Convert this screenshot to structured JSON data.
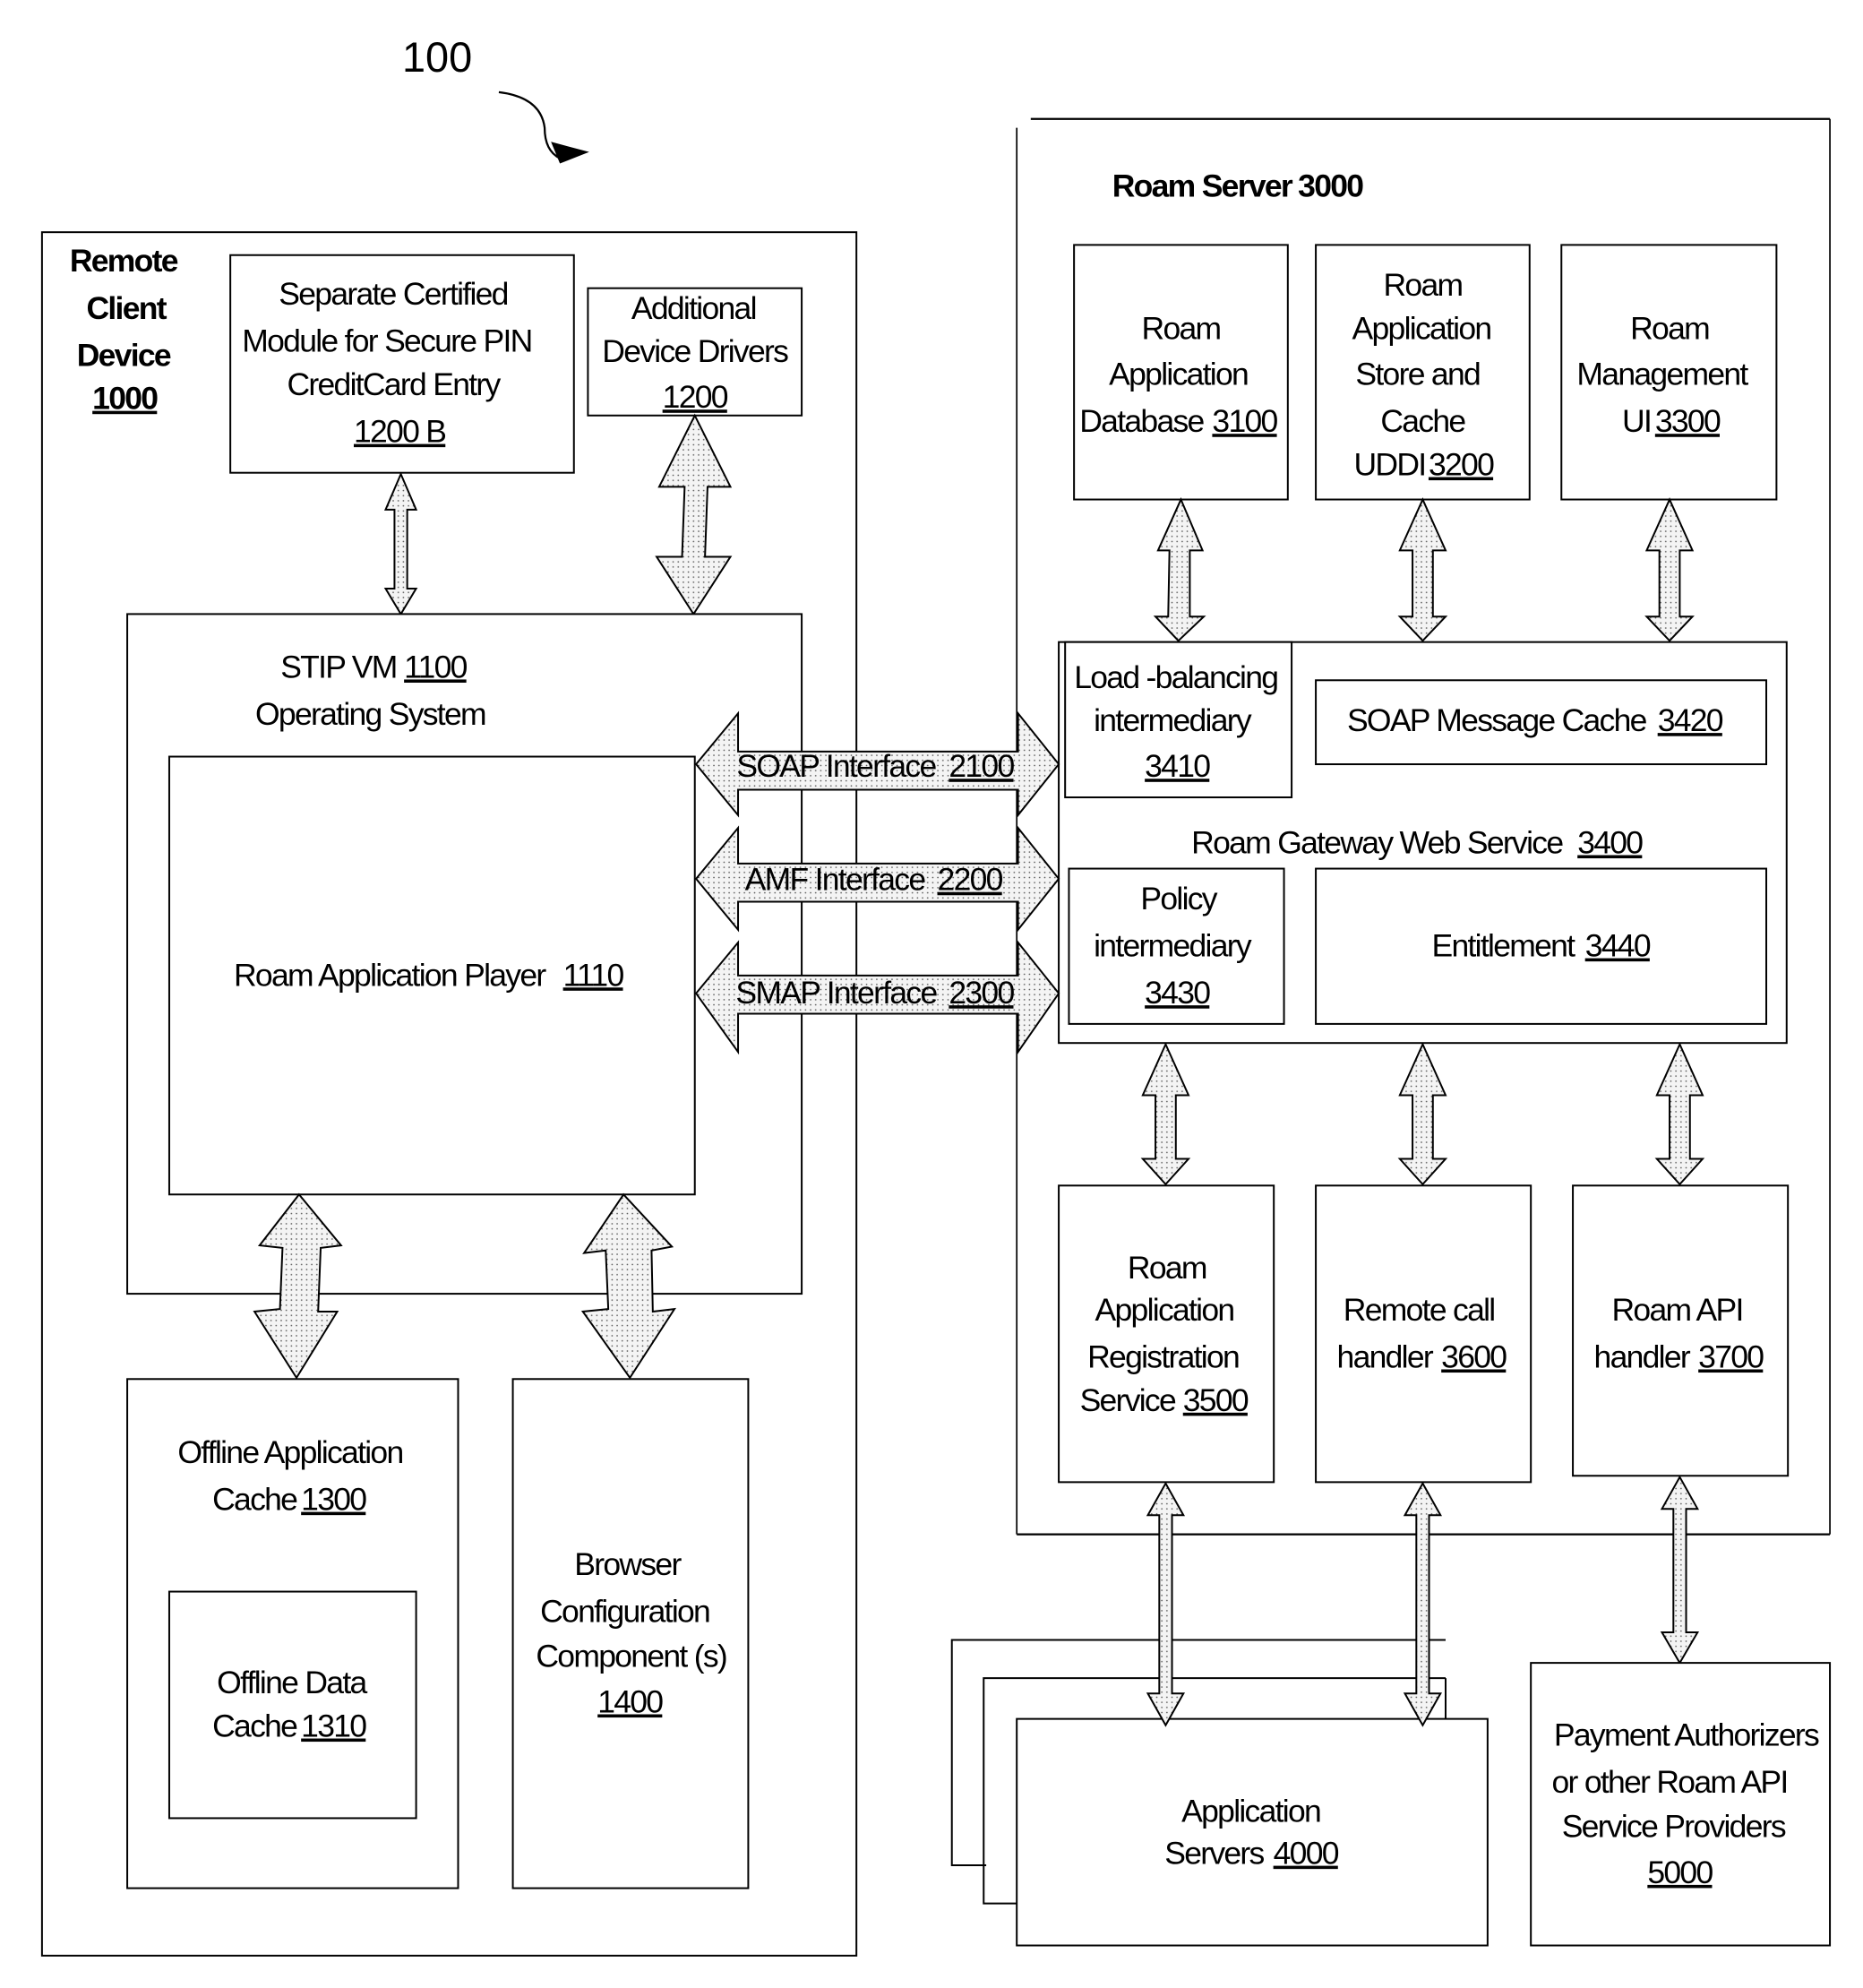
{
  "figure": {
    "ref": "100",
    "remote_client": {
      "title_lines": [
        "Remote",
        "Client",
        "Device"
      ],
      "ref": "1000",
      "secure_pin": {
        "lines": [
          "Separate Certified",
          "Module for Secure PIN",
          "CreditCard Entry"
        ],
        "ref": "1200 B"
      },
      "drivers": {
        "lines": [
          "Additional",
          "Device Drivers"
        ],
        "ref": "1200"
      },
      "stip_vm": {
        "label": "STIP VM",
        "ref": "1100",
        "subtitle": "Operating System"
      },
      "player": {
        "label": "Roam Application Player",
        "ref": "1110"
      },
      "offline_app_cache": {
        "lines": [
          "Offline Application",
          "Cache"
        ],
        "ref": "1300"
      },
      "offline_data_cache": {
        "lines": [
          "Offline Data",
          "Cache"
        ],
        "ref": "1310"
      },
      "browser_config": {
        "lines": [
          "Browser",
          "Configuration",
          "Component (s)"
        ],
        "ref": "1400"
      }
    },
    "interfaces": [
      {
        "label": "SOAP Interface",
        "ref": "2100"
      },
      {
        "label": "AMF Interface",
        "ref": "2200"
      },
      {
        "label": "SMAP Interface",
        "ref": "2300"
      }
    ],
    "roam_server": {
      "title": "Roam Server",
      "ref": "3000",
      "database": {
        "lines": [
          "Roam",
          "Application",
          "Database"
        ],
        "ref": "3100"
      },
      "store": {
        "lines": [
          "Roam",
          "Application",
          "Store and",
          "Cache",
          "UDDI"
        ],
        "ref": "3200"
      },
      "mgmt": {
        "lines": [
          "Roam",
          "Management",
          "UI"
        ],
        "ref": "3300"
      },
      "gateway": {
        "label": "Roam Gateway Web Service",
        "ref": "3400"
      },
      "load_balancing": {
        "lines": [
          "Load -balancing",
          "intermediary"
        ],
        "ref": "3410"
      },
      "soap_cache": {
        "label": "SOAP Message Cache",
        "ref": "3420"
      },
      "policy": {
        "lines": [
          "Policy",
          "intermediary"
        ],
        "ref": "3430"
      },
      "entitlement": {
        "label": "Entitlement",
        "ref": "3440"
      },
      "registration": {
        "lines": [
          "Roam",
          "Application",
          "Registration",
          "Service"
        ],
        "ref": "3500"
      },
      "remote_call": {
        "lines": [
          "Remote call",
          "handler"
        ],
        "ref": "3600"
      },
      "api_handler": {
        "lines": [
          "Roam API",
          "handler"
        ],
        "ref": "3700"
      }
    },
    "app_servers": {
      "lines": [
        "Application",
        "Servers"
      ],
      "ref": "4000"
    },
    "payment": {
      "lines": [
        "Payment Authorizers",
        "or other Roam API",
        "Service Providers"
      ],
      "ref": "5000"
    }
  }
}
